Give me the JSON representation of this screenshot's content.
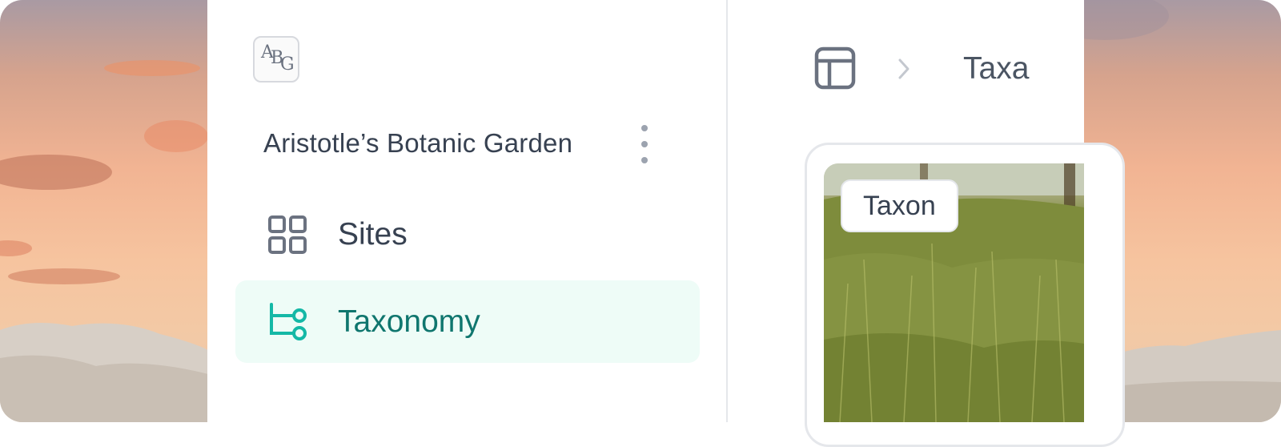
{
  "sidebar": {
    "logo_text": "ABG",
    "org_name": "Aristotle’s Botanic Garden",
    "items": [
      {
        "label": "Sites",
        "icon": "grid-icon",
        "active": false
      },
      {
        "label": "Taxonomy",
        "icon": "hierarchy-icon",
        "active": true
      }
    ]
  },
  "breadcrumb": {
    "root_icon": "table-icon",
    "current": "Taxa"
  },
  "card": {
    "badge": "Taxon"
  },
  "colors": {
    "accent": "#14b8a6",
    "accent_text": "#0f766e",
    "active_bg": "#eefcf7",
    "text": "#374151",
    "muted": "#9ca3af"
  }
}
